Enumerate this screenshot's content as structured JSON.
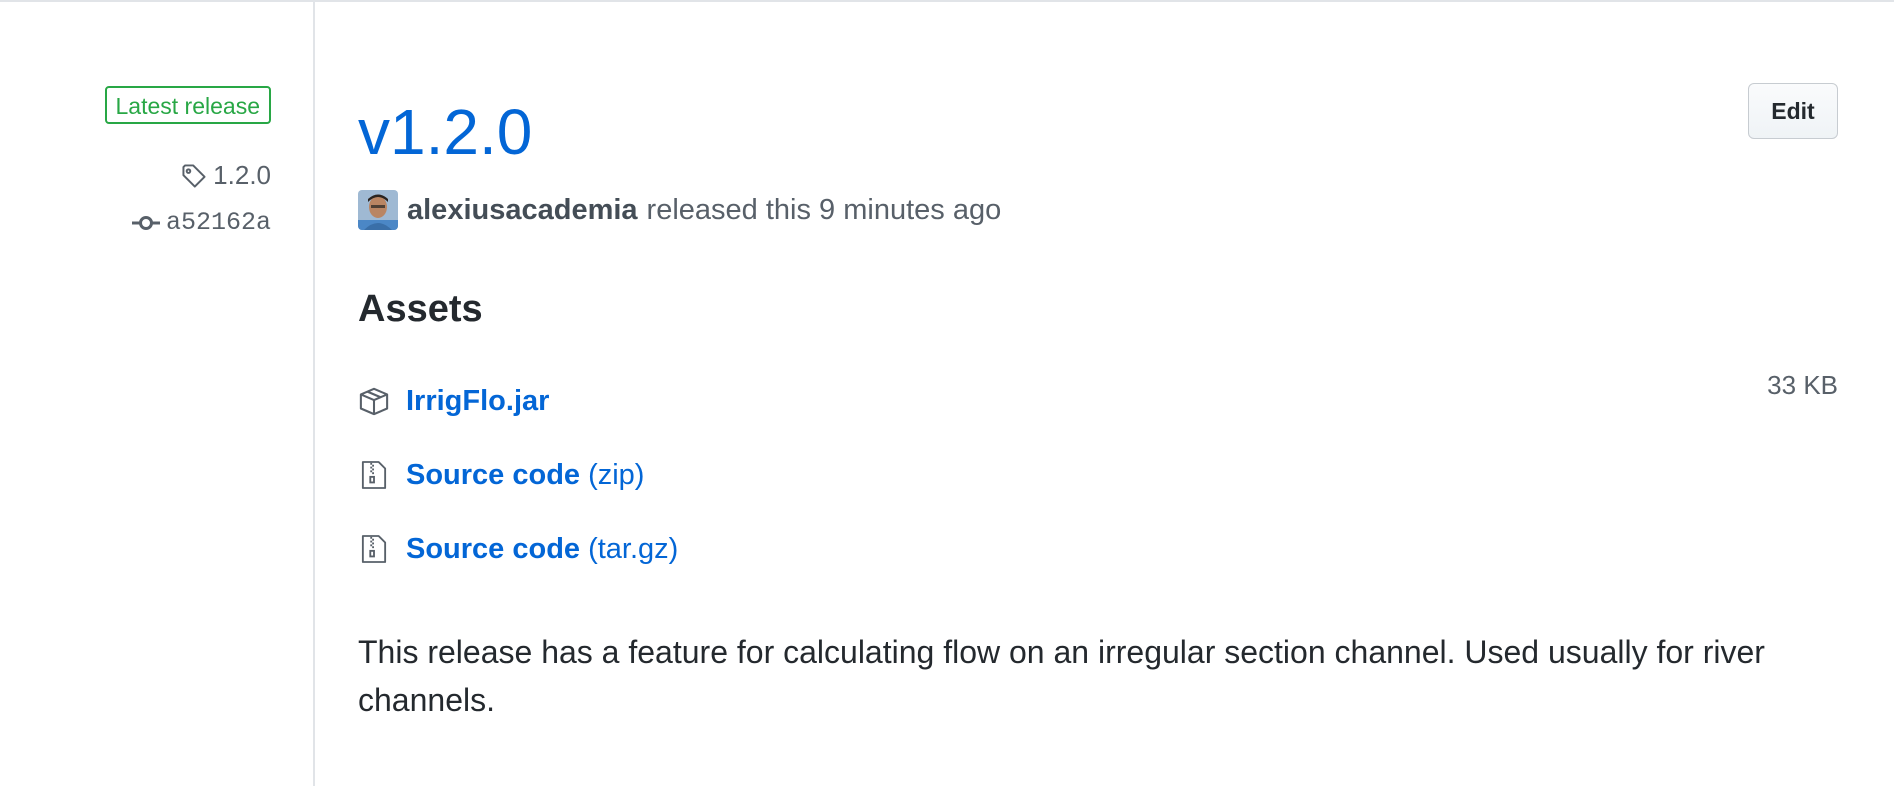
{
  "sidebar": {
    "badge_label": "Latest release",
    "tag": "1.2.0",
    "commit": "a52162a"
  },
  "release": {
    "title": "v1.2.0",
    "edit_label": "Edit",
    "author": "alexiusacademia",
    "released_text": "released this 9 minutes ago"
  },
  "assets": {
    "heading": "Assets",
    "items": [
      {
        "name": "IrrigFlo.jar",
        "ext": "",
        "size": "33 KB",
        "icon": "package-icon"
      },
      {
        "name": "Source code",
        "ext": "(zip)",
        "size": "",
        "icon": "file-zip-icon"
      },
      {
        "name": "Source code",
        "ext": "(tar.gz)",
        "size": "",
        "icon": "file-zip-icon"
      }
    ]
  },
  "description": "This release has a feature for calculating flow on an irregular section channel. Used usually for river channels.",
  "colors": {
    "link": "#0366d6",
    "badge_green": "#28a745",
    "muted": "#586069",
    "border": "#e1e4e8"
  }
}
